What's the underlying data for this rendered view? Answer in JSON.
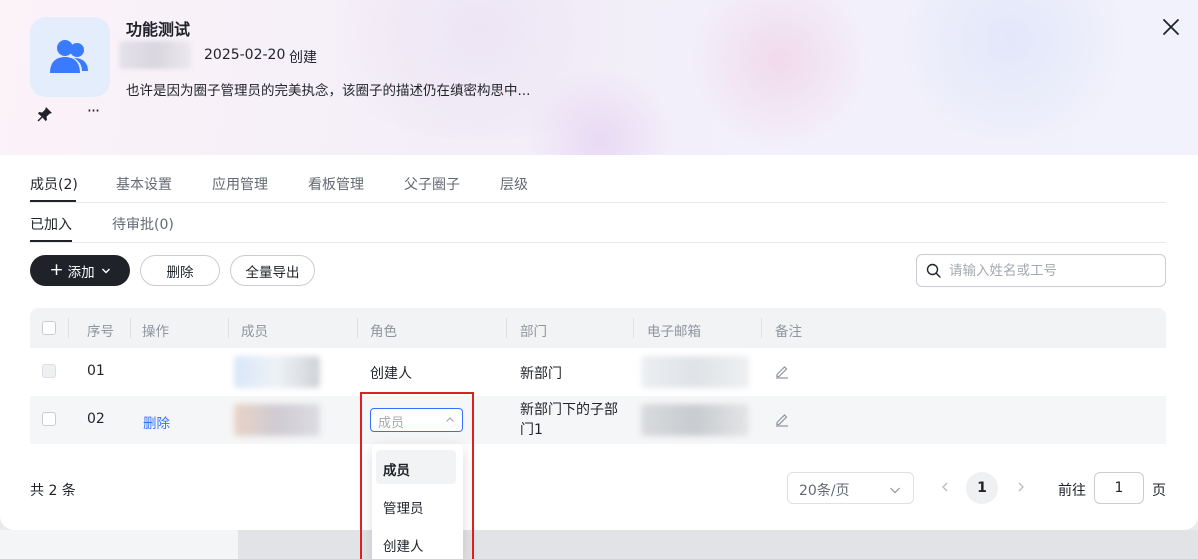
{
  "header": {
    "title": "功能测试",
    "created_date": "2025-02-20",
    "created_label": "创建",
    "description": "也许是因为圈子管理员的完美执念，该圈子的描述仍在缜密构思中..."
  },
  "tabs": [
    "成员(2)",
    "基本设置",
    "应用管理",
    "看板管理",
    "父子圈子",
    "层级"
  ],
  "subtabs": [
    "已加入",
    "待审批(0)"
  ],
  "toolbar": {
    "add_label": "添加",
    "delete_label": "删除",
    "export_label": "全量导出",
    "search_placeholder": "请输入姓名或工号"
  },
  "table": {
    "columns": [
      "序号",
      "操作",
      "成员",
      "角色",
      "部门",
      "电子邮箱",
      "备注"
    ],
    "rows": [
      {
        "index": "01",
        "action": "",
        "role": "创建人",
        "department": "新部门"
      },
      {
        "index": "02",
        "action": "删除",
        "role_select": "成员",
        "department_line1": "新部门下的子部",
        "department_line2": "门1"
      }
    ]
  },
  "role_dropdown": {
    "options": [
      "成员",
      "管理员",
      "创建人"
    ],
    "selected": "成员"
  },
  "pagination": {
    "total": "共 2 条",
    "page_size": "20条/页",
    "current_page": "1",
    "goto_label": "前往",
    "goto_value": "1",
    "page_suffix": "页"
  },
  "colors": {
    "primary": "#1f2329",
    "link": "#3370ff",
    "highlight": "#e02020",
    "avatar_bg": "#e3edfb",
    "avatar_icon": "#3a7afe"
  }
}
